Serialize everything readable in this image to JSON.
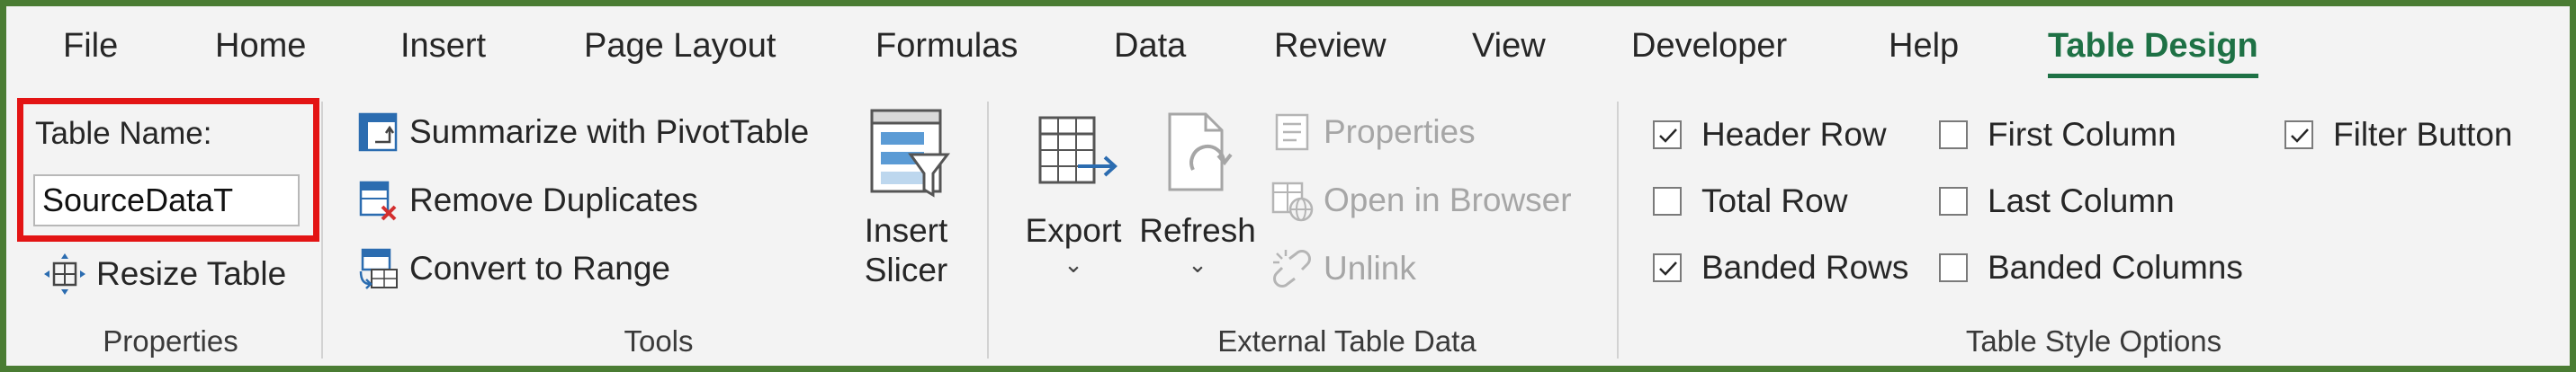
{
  "tabs": [
    {
      "label": "File"
    },
    {
      "label": "Home"
    },
    {
      "label": "Insert"
    },
    {
      "label": "Page Layout"
    },
    {
      "label": "Formulas"
    },
    {
      "label": "Data"
    },
    {
      "label": "Review"
    },
    {
      "label": "View"
    },
    {
      "label": "Developer"
    },
    {
      "label": "Help"
    },
    {
      "label": "Table Design",
      "active": true
    }
  ],
  "properties": {
    "table_name_label": "Table Name:",
    "table_name_value": "SourceDataT",
    "resize_label": "Resize Table",
    "group_label": "Properties"
  },
  "tools": {
    "summarize_label": "Summarize with PivotTable",
    "remove_dup_label": "Remove Duplicates",
    "convert_label": "Convert to Range",
    "insert_slicer_line1": "Insert",
    "insert_slicer_line2": "Slicer",
    "group_label": "Tools"
  },
  "external": {
    "export_label": "Export",
    "refresh_label": "Refresh",
    "properties_label": "Properties",
    "open_browser_label": "Open in Browser",
    "unlink_label": "Unlink",
    "group_label": "External Table Data"
  },
  "style_options": {
    "header_row": {
      "label": "Header Row",
      "checked": true
    },
    "total_row": {
      "label": "Total Row",
      "checked": false
    },
    "banded_rows": {
      "label": "Banded Rows",
      "checked": true
    },
    "first_column": {
      "label": "First Column",
      "checked": false
    },
    "last_column": {
      "label": "Last Column",
      "checked": false
    },
    "banded_columns": {
      "label": "Banded Columns",
      "checked": false
    },
    "filter_button": {
      "label": "Filter Button",
      "checked": true
    },
    "group_label": "Table Style Options"
  },
  "colors": {
    "frame_border": "#4a7c33",
    "active_tab": "#1e7145",
    "highlight": "#e31414",
    "ribbon_bg": "#f3f3f3"
  }
}
